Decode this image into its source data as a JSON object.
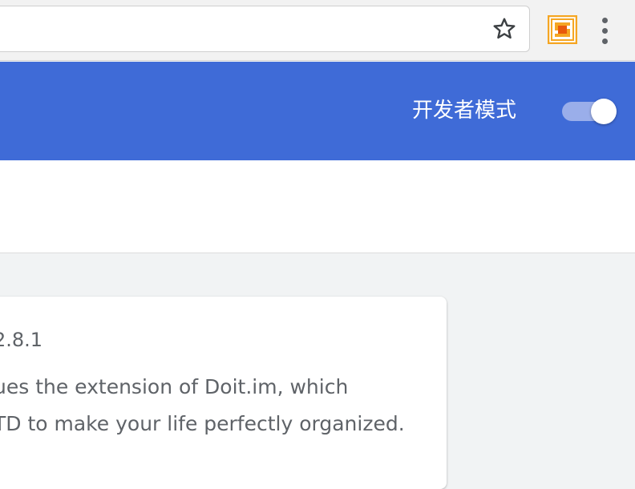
{
  "toolbar": {
    "bookmark_icon": "star-outline-icon",
    "extension_icon": "doit-extension-icon",
    "menu_icon": "vertical-dots-menu-icon"
  },
  "header": {
    "developer_mode_label": "开发者模式",
    "developer_mode_enabled": true,
    "accent_color": "#3f6bd7"
  },
  "extension_card": {
    "version": "2.8.1",
    "description_line1": "ues the extension of Doit.im, which",
    "description_line2": "TD to make your life perfectly organized."
  },
  "colors": {
    "toolbar_bg": "#f2f2f2",
    "page_bg": "#f1f3f4",
    "toggle_track": "#9aaeea",
    "extension_orange": "#f5a623"
  }
}
